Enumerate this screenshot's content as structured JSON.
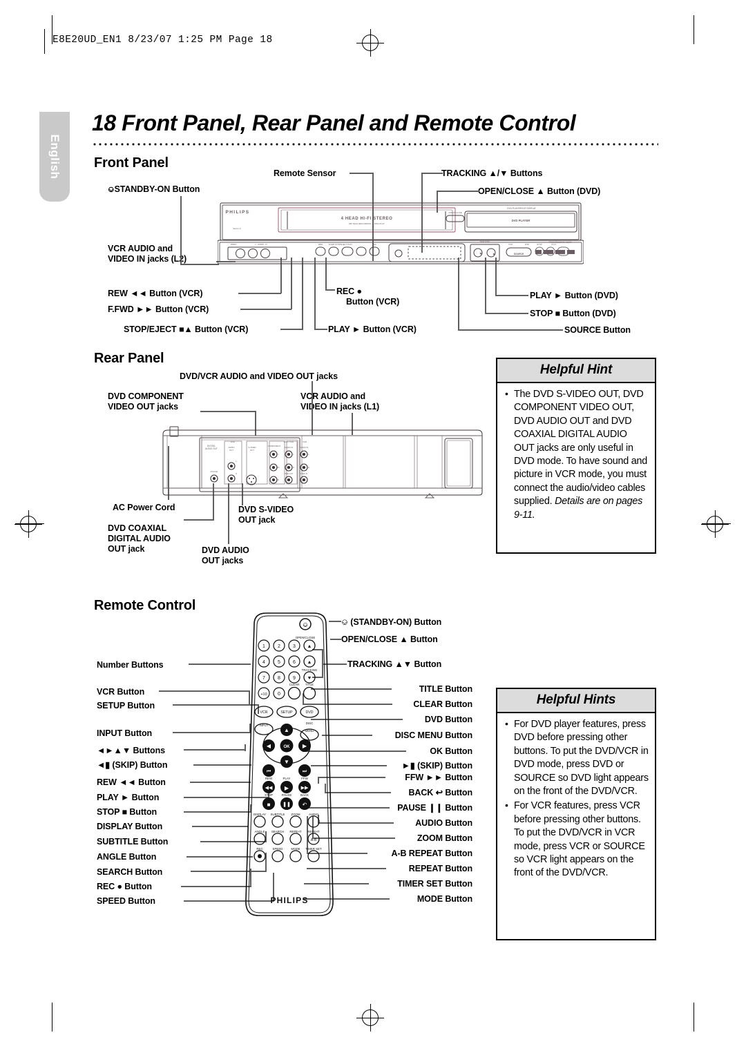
{
  "header": {
    "file_info": "E8E20UD_EN1  8/23/07  1:25 PM  Page 18"
  },
  "sidebar": {
    "language_tab": "English"
  },
  "title": {
    "number": "18",
    "text": "Front Panel, Rear Panel and Remote Control",
    "full": "18  Front Panel, Rear Panel and Remote Control"
  },
  "sections": {
    "front_panel": "Front Panel",
    "rear_panel": "Rear Panel",
    "remote_control": "Remote Control"
  },
  "front_panel_labels": {
    "standby_on": "STANDBY-ON Button",
    "remote_sensor": "Remote Sensor",
    "tracking": "TRACKING ▲/▼ Buttons",
    "open_close": "OPEN/CLOSE ▲ Button (DVD)",
    "vcr_audio_1": "VCR AUDIO and",
    "vcr_audio_2": "VIDEO IN jacks (L2)",
    "rew": "REW ◄◄ Button (VCR)",
    "ffwd": "F.FWD ►► Button (VCR)",
    "stop_eject": "STOP/EJECT ■▲ Button (VCR)",
    "rec_1": "REC ●",
    "rec_2": "Button (VCR)",
    "play_vcr": "PLAY ► Button (VCR)",
    "play_dvd": "PLAY ► Button (DVD)",
    "stop_dvd": "STOP ■ Button (DVD)",
    "source": "SOURCE Button"
  },
  "device_front": {
    "brand": "PHILIPS",
    "model_line_1": "4 HEAD HI-FI STEREO",
    "model_line_2": "DB TECH RECORDING · LONG PLAY",
    "standby_text": "STANDBY-ON",
    "open_close_text": "OPEN/CLOSE",
    "display_label": "DVD PLAYER/VCR DISPLAY",
    "display_text": "DVD PLAYER",
    "tracking_text": "TRACKING",
    "source_text": "SOURCE",
    "jack_labels": [
      "VIDEO",
      "L - AUDIO - R"
    ],
    "btn_labels": [
      "REW",
      "F.FWD",
      "STOP/EJECT",
      "PLAY",
      "REC"
    ],
    "dvd_btn_labels": [
      "STOP",
      "PLAY"
    ],
    "mode_labels": [
      "VCR",
      "DVD"
    ],
    "logos": "PROGRESSIVE SCAN"
  },
  "rear_panel_labels": {
    "dvd_vcr_out": "DVD/VCR AUDIO and VIDEO OUT jacks",
    "dvd_component_1": "DVD COMPONENT",
    "dvd_component_2": "VIDEO OUT jacks",
    "vcr_audio_1": "VCR AUDIO and",
    "vcr_audio_2": "VIDEO IN jacks (L1)",
    "ac_power": "AC Power Cord",
    "dvd_coaxial_1": "DVD COAXIAL",
    "dvd_coaxial_2": "DIGITAL AUDIO",
    "dvd_coaxial_3": "OUT jack",
    "dvd_audio_1": "DVD AUDIO",
    "dvd_audio_2": "OUT jacks",
    "dvd_svideo_1": "DVD S-VIDEO",
    "dvd_svideo_2": "OUT jack"
  },
  "device_rear": {
    "digital_audio_out": "DIGITAL AUDIO OUT",
    "coaxial": "COAXIAL",
    "dvd": "DVD",
    "audio_out": "AUDIO OUT",
    "s_video_out": "S-VIDEO OUT",
    "component": "COMPONENT",
    "dvd_vcr": "DVD / VCR",
    "vcr": "VCR",
    "audio_in": "AUDIO IN",
    "video_out": "VIDEO OUT",
    "video_in": "VIDEO IN",
    "channels": [
      "L",
      "R",
      "Y",
      "Pb",
      "Pr"
    ]
  },
  "remote_labels_left": {
    "number_buttons": "Number Buttons",
    "vcr": "VCR Button",
    "setup": "SETUP Button",
    "input": "INPUT Button",
    "arrows": "◄►▲▼ Buttons",
    "skip_prev": "◄▮ (SKIP) Button",
    "rew": "REW ◄◄ Button",
    "play": "PLAY ► Button",
    "stop": "STOP ■ Button",
    "display": "DISPLAY Button",
    "subtitle": "SUBTITLE Button",
    "angle": "ANGLE Button",
    "search": "SEARCH Button",
    "rec": "REC ● Button",
    "speed": "SPEED Button"
  },
  "remote_labels_right": {
    "standby": "(STANDBY-ON) Button",
    "open_close": "OPEN/CLOSE ▲ Button",
    "tracking": "TRACKING ▲▼ Button",
    "title": "TITLE Button",
    "clear": "CLEAR Button",
    "dvd": "DVD Button",
    "disc_menu": "DISC MENU Button",
    "ok": "OK Button",
    "skip_next": "►▮ (SKIP) Button",
    "ffw": "FFW ►► Button",
    "back": "BACK ↩ Button",
    "pause": "PAUSE ❙❙ Button",
    "audio": "AUDIO Button",
    "zoom": "ZOOM Button",
    "ab_repeat": "A-B REPEAT Button",
    "repeat": "REPEAT Button",
    "timer_set": "TIMER SET Button",
    "mode": "MODE Button"
  },
  "device_remote": {
    "brand": "PHILIPS",
    "number_keys": [
      "1",
      "2",
      "3",
      "4",
      "5",
      "6",
      "7",
      "8",
      "9",
      "+10",
      "0"
    ],
    "open_close": "OPEN/CLOSE",
    "tracking": "TRACKING",
    "clear": "CLEAR",
    "title": "TITLE",
    "vcr": "VCR",
    "setup": "SETUP",
    "dvd": "DVD",
    "input": "INPUT",
    "disc_menu_1": "DISC",
    "disc_menu_2": "MENU",
    "ok": "OK",
    "rew": "REW",
    "play": "PLAY",
    "ffw": "FFW",
    "stop": "STOP",
    "pause": "PAUSE",
    "back": "BACK",
    "display": "DISPLAY",
    "subtitle": "SUBTITLE",
    "zoom": "ZOOM",
    "audio": "AUDIO",
    "angle": "ANGLE",
    "search": "SEARCH",
    "repeat": "REPEAT",
    "ab_repeat_1": "REPEAT",
    "ab_repeat_2": "A-B",
    "rec": "REC",
    "speed": "SPEED",
    "mode": "MODE",
    "timer_set": "TIMER SET"
  },
  "helpful_hint": {
    "heading": "Helpful Hint",
    "body_part1": "The DVD S-VIDEO OUT, DVD COMPONENT VIDEO OUT, DVD AUDIO OUT and DVD COAXIAL DIGITAL AUDIO OUT jacks are only useful in DVD mode. To have sound and picture in VCR mode, you must connect the audio/video cables supplied. ",
    "body_italic": "Details are on pages 9-11."
  },
  "helpful_hints": {
    "heading": "Helpful Hints",
    "bullet1": "For DVD player features, press DVD before pressing other buttons. To put the DVD/VCR in DVD mode, press DVD or SOURCE so DVD light appears on the front of the DVD/VCR.",
    "bullet2": "For VCR features, press VCR before pressing other buttons. To put the DVD/VCR in VCR mode, press VCR or SOURCE so VCR light appears on the front of the DVD/VCR."
  },
  "colors": {
    "line": "#5f5f5f",
    "hint_header_bg": "#dcdcdc",
    "tab_bg": "#c9c9c9"
  }
}
